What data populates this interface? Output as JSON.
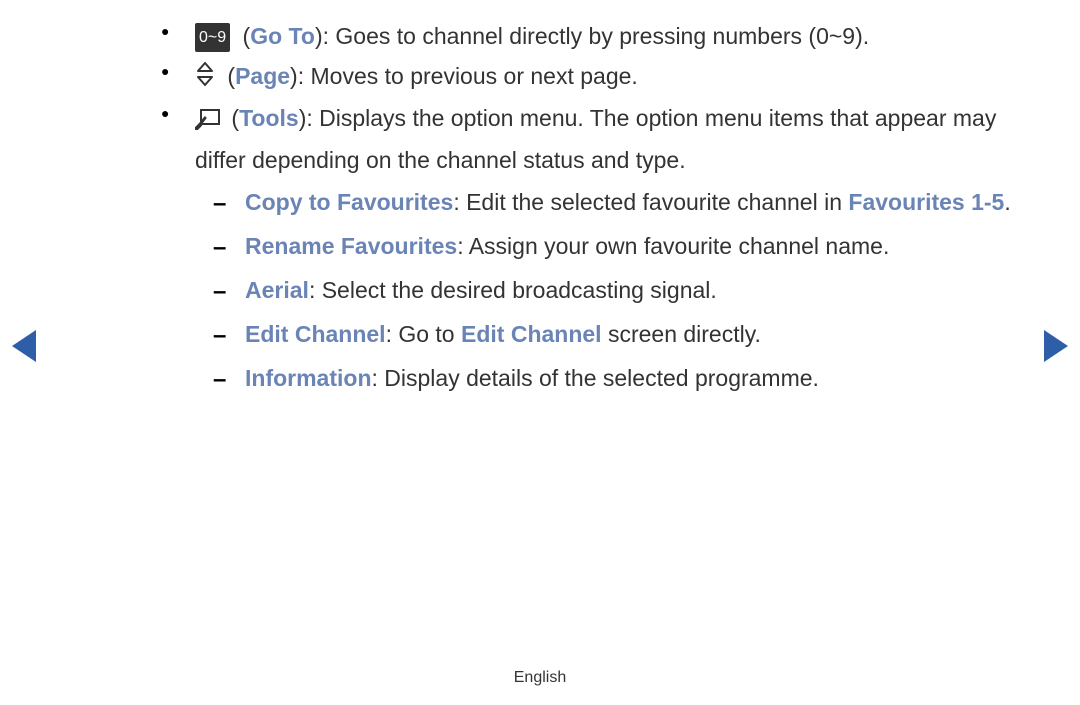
{
  "colors": {
    "blue": "#6a84b5",
    "navArrow": "#2e5ea8",
    "badgeBg": "#333"
  },
  "bullets": [
    {
      "icon": "badge-09",
      "iconText": "0~9",
      "label": "Go To",
      "desc": ": Goes to channel directly by pressing numbers (0~9)."
    },
    {
      "icon": "updown",
      "label": "Page",
      "desc": ": Moves to previous or next page."
    },
    {
      "icon": "tools",
      "label": "Tools",
      "desc": ": Displays the option menu. The option menu items that appear may differ depending on the channel status and type.",
      "sub": [
        {
          "label": "Copy to Favourites",
          "pre": ": Edit the selected favourite channel in ",
          "emph": "Favourites 1-5",
          "post": "."
        },
        {
          "label": "Rename Favourites",
          "pre": ": Assign your own favourite channel name."
        },
        {
          "label": "Aerial",
          "pre": ": Select the desired broadcasting signal."
        },
        {
          "label": "Edit Channel",
          "pre": ": Go to ",
          "emph": "Edit Channel",
          "post": " screen directly."
        },
        {
          "label": "Information",
          "pre": ": Display details of the selected programme."
        }
      ]
    }
  ],
  "footer": "English"
}
